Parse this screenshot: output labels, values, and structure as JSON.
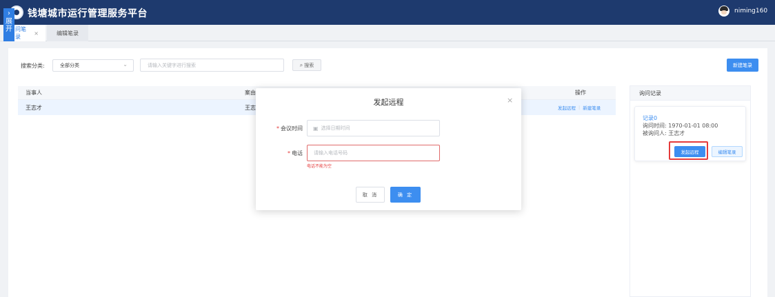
{
  "header": {
    "app_title": "钱塘城市运行管理服务平台",
    "user_name": "niming160",
    "logo_icon": "city-seal-icon",
    "avatar_icon": "user-avatar-icon"
  },
  "sidebar_toggle": {
    "chevron": "›",
    "label": "展开"
  },
  "tabs": [
    {
      "label": "问笔录",
      "close": "×"
    },
    {
      "label": "编辑笔录"
    }
  ],
  "filters": {
    "category_label": "搜索分类:",
    "category_value": "全部分类",
    "search_placeholder": "请输入关键字进行搜索",
    "search_button": "搜索",
    "new_button": "新建笔录"
  },
  "table": {
    "headers": [
      "当事人",
      "案由",
      "操作"
    ],
    "rows": [
      {
        "party": "王志才",
        "cause": "王志",
        "ops": [
          "发起远程",
          "新建笔录"
        ]
      }
    ]
  },
  "right_panel": {
    "title": "询问记录",
    "record": {
      "title": "记录0",
      "time_line": "询问时间:  1970-01-01 08:00",
      "person_line": "被询问人:  王志才",
      "start_button": "发起远程",
      "edit_button": "编辑笔录"
    }
  },
  "dialog": {
    "title": "发起远程",
    "close": "×",
    "time_label": "会议时间",
    "time_placeholder": "选择日期时间",
    "phone_label": "电话",
    "phone_placeholder": "请输入电话号码",
    "phone_error": "电话不能为空",
    "required_mark": "*",
    "cancel": "取 消",
    "confirm": "确 定"
  },
  "colors": {
    "topbar": "#1e3a6e",
    "primary": "#3d8ef0",
    "error": "#e53a3a"
  }
}
